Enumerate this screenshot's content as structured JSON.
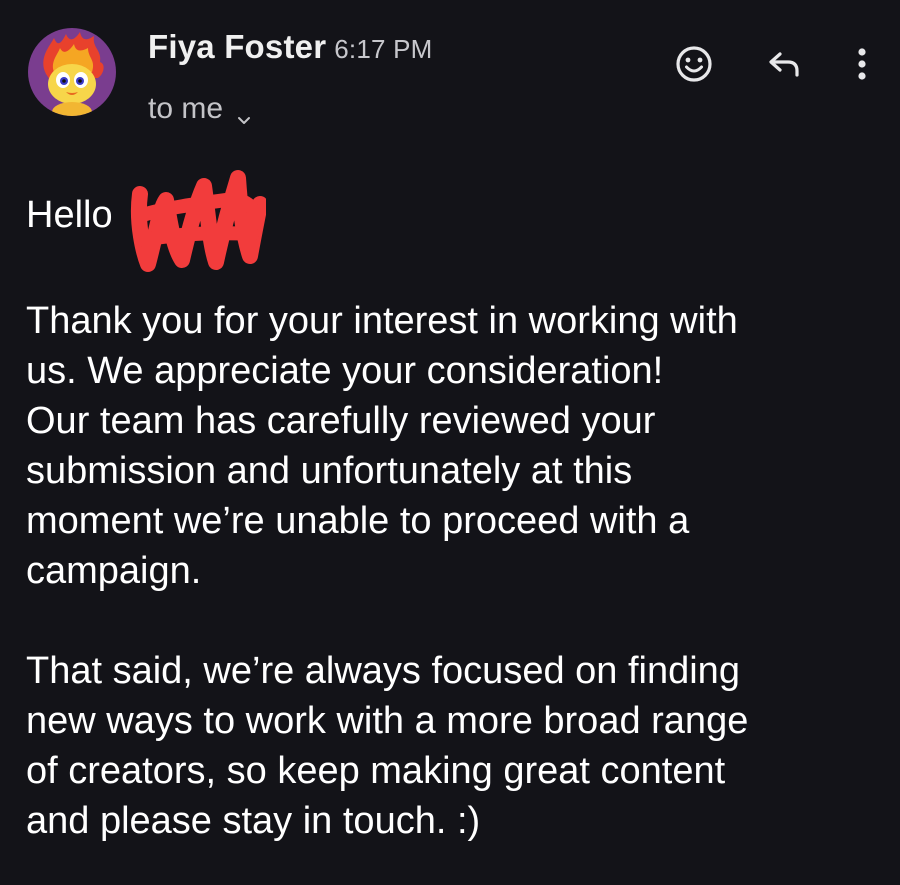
{
  "sender": {
    "name": "Fiya Foster",
    "time": "6:17 PM",
    "recipient": "to me",
    "avatar_icon": "flame-mascot-avatar"
  },
  "actions": {
    "emoji": "smiley-face-icon",
    "reply": "reply-arrow-icon",
    "more": "more-vertical-icon"
  },
  "body": {
    "greeting_prefix": "Hello",
    "greeting_suffix": "!",
    "paragraph1": [
      "Thank you for your interest in working with",
      "us. We appreciate your consideration!",
      "Our team has carefully reviewed your",
      "submission and unfortunately at this",
      "moment we’re unable to proceed with a",
      "campaign."
    ],
    "paragraph2": [
      "That said, we’re always focused on finding",
      "new ways to work with a more broad range",
      "of creators, so keep making great content",
      "and please stay in touch. :)"
    ]
  },
  "colors": {
    "background": "#131318",
    "text": "#ffffff",
    "muted_text": "#c4c4c8",
    "redaction": "#f23c3c",
    "avatar_bg": "#7a3d8f"
  }
}
